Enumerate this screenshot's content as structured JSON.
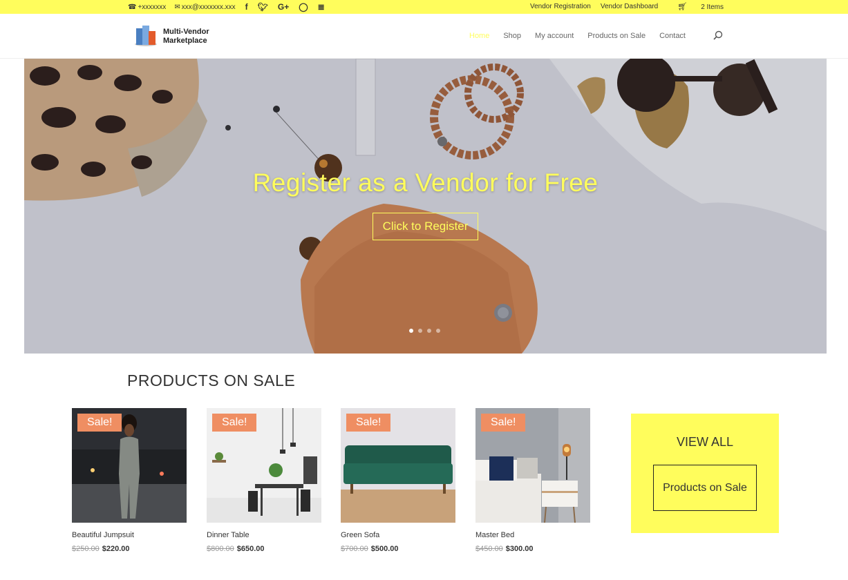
{
  "topbar": {
    "phone": "+xxxxxxx",
    "email": "xxx@xxxxxxx.xxx",
    "social": [
      "f",
      "t",
      "G+",
      "ig",
      "rss"
    ],
    "vendor_registration": "Vendor Registration",
    "vendor_dashboard": "Vendor Dashboard",
    "cart": "2 Items"
  },
  "header": {
    "logo_line1": "Multi-Vendor",
    "logo_line2": "Marketplace",
    "nav": [
      "Home",
      "Shop",
      "My account",
      "Products on Sale",
      "Contact"
    ]
  },
  "hero": {
    "title": "Register as a Vendor for Free",
    "button": "Click to Register",
    "slides": 4,
    "active_slide": 1
  },
  "section": {
    "title": "PRODUCTS ON SALE"
  },
  "products": [
    {
      "badge": "Sale!",
      "name": "Beautiful Jumpsuit",
      "old_price": "$250.00",
      "new_price": "$220.00"
    },
    {
      "badge": "Sale!",
      "name": "Dinner Table",
      "old_price": "$800.00",
      "new_price": "$650.00"
    },
    {
      "badge": "Sale!",
      "name": "Green Sofa",
      "old_price": "$700.00",
      "new_price": "$500.00"
    },
    {
      "badge": "Sale!",
      "name": "Master Bed",
      "old_price": "$450.00",
      "new_price": "$300.00"
    }
  ],
  "viewall": {
    "title": "VIEW ALL",
    "button": "Products on Sale"
  },
  "colors": {
    "accent": "#fffd5c",
    "sale_badge": "#ef8e62"
  }
}
